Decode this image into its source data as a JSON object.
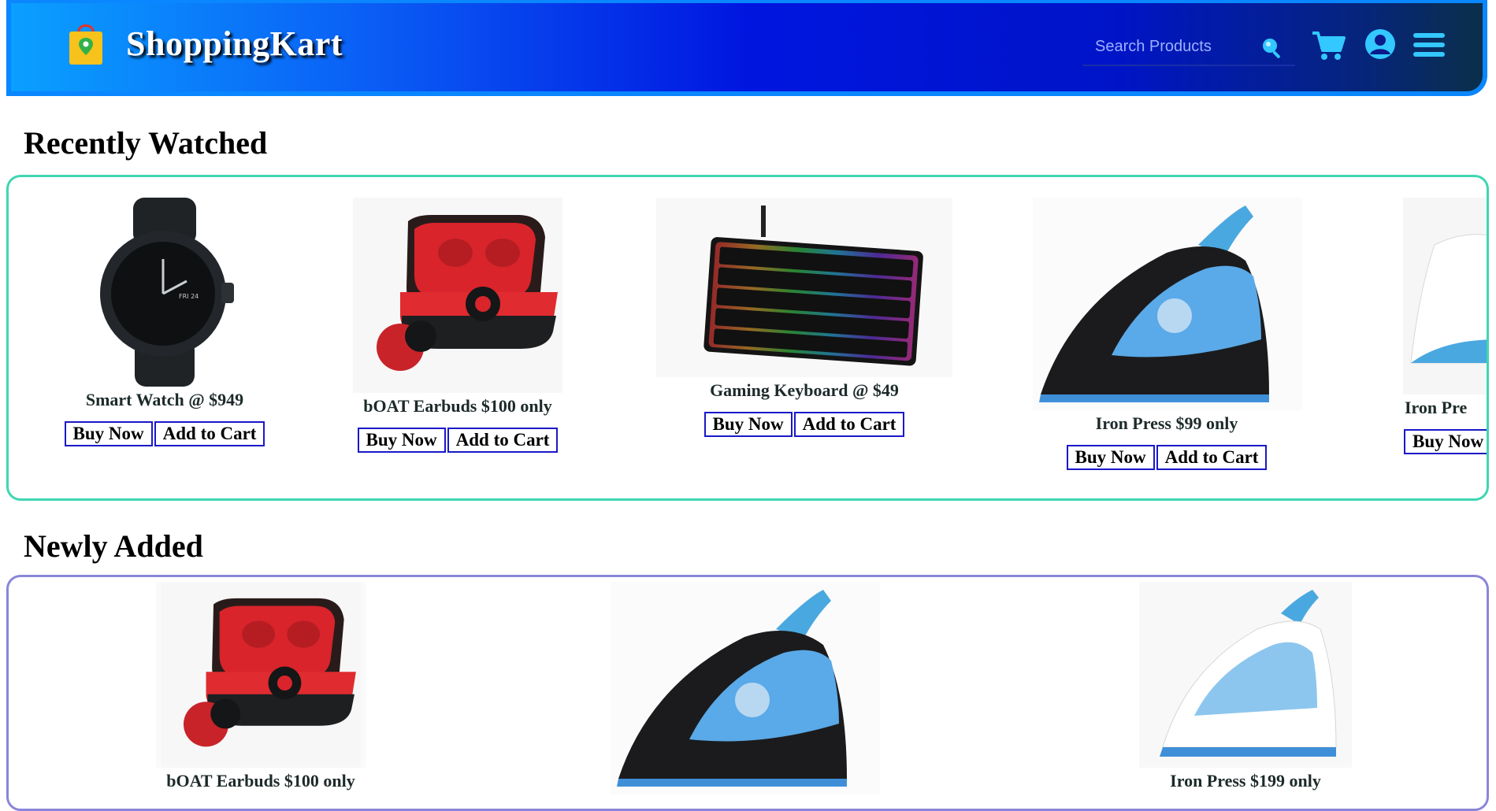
{
  "header": {
    "brand": "ShoppingKart",
    "search_placeholder": "Search Products",
    "logo_icon": "shopping-bag-location-icon",
    "icons": [
      "search-icon",
      "cart-icon",
      "user-icon",
      "menu-icon"
    ]
  },
  "colors": {
    "header_gradient_start": "#0aa0ff",
    "header_gradient_mid": "#0014c8",
    "header_gradient_end": "#0b2f4a",
    "recent_border": "#3fd6b2",
    "new_border": "#8a86d8",
    "button_border": "#1a18c8"
  },
  "recently_watched": {
    "title": "Recently Watched",
    "items": [
      {
        "name": "Smart Watch @ $949",
        "buy": "Buy Now",
        "cart": "Add to Cart"
      },
      {
        "name": "bOAT Earbuds $100 only",
        "buy": "Buy Now",
        "cart": "Add to Cart"
      },
      {
        "name": "Gaming Keyboard @ $49",
        "buy": "Buy Now",
        "cart": "Add to Cart"
      },
      {
        "name": "Iron Press $99 only",
        "buy": "Buy Now",
        "cart": "Add to Cart"
      },
      {
        "name": "Iron Pre",
        "buy": "Buy Now",
        "cart": ""
      }
    ]
  },
  "newly_added": {
    "title": "Newly Added",
    "items": [
      {
        "name": "bOAT Earbuds $100 only"
      },
      {
        "name": ""
      },
      {
        "name": "Iron Press $199 only"
      }
    ]
  }
}
